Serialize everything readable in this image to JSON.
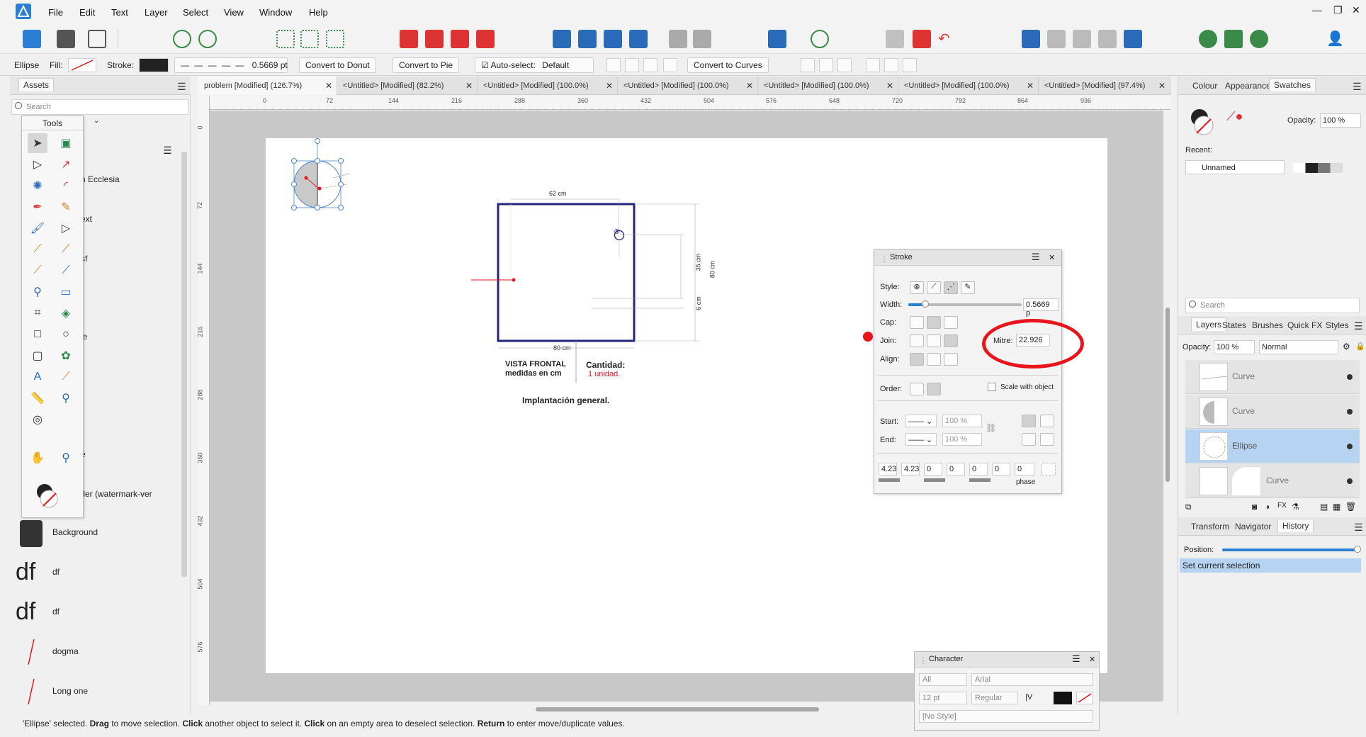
{
  "menu": [
    "File",
    "Edit",
    "Text",
    "Layer",
    "Select",
    "View",
    "Window",
    "Help"
  ],
  "context": {
    "shape": "Ellipse",
    "fill_label": "Fill:",
    "stroke_label": "Stroke:",
    "stroke_width": "0.5669 pt",
    "convert_donut": "Convert to Donut",
    "convert_pie": "Convert to Pie",
    "autoselect_label": "Auto-select:",
    "autoselect_value": "Default",
    "convert_curves": "Convert to Curves"
  },
  "assets": {
    "tab": "Assets",
    "search_placeholder": "Search",
    "category": "Tools",
    "items": [
      {
        "label": "n Ecclesia"
      },
      {
        "label": "ext"
      },
      {
        "label": "sf"
      },
      {
        "label": "le"
      },
      {
        "label": "e"
      },
      {
        "label": "tler (watermark-ver"
      },
      {
        "label": "Background"
      },
      {
        "label": "df",
        "thumb": "df"
      },
      {
        "label": "df",
        "thumb": "df"
      },
      {
        "label": "dogma"
      },
      {
        "label": "Long one"
      }
    ]
  },
  "doc_tabs": [
    "problem [Modified] (126.7%)",
    "<Untitled> [Modified] (82.2%)",
    "<Untitled> [Modified] (100.0%)",
    "<Untitled> [Modified] (100.0%)",
    "<Untitled> [Modified] (100.0%)",
    "<Untitled> [Modified] (100.0%)",
    "<Untitled> [Modified] (97.4%)"
  ],
  "ruler_h": [
    "0",
    "72",
    "144",
    "216",
    "288",
    "360",
    "432",
    "504",
    "576",
    "648",
    "720",
    "792",
    "864",
    "936"
  ],
  "ruler_v": [
    "0",
    "72",
    "144",
    "216",
    "288",
    "360",
    "432",
    "504",
    "576"
  ],
  "ruler_unit": "pt",
  "drawing": {
    "dim_top": "62 cm",
    "dim_bottom": "80 cm",
    "dim_right_35": "35 cm",
    "dim_right_80": "80 cm",
    "dim_right_6": "6 cm",
    "vista_line1": "VISTA FRONTAL",
    "vista_line2": "medidas en cm",
    "cantidad_label": "Cantidad:",
    "cantidad_value": "1 unidad.",
    "implantacion": "Implantación general.",
    "registered": "®"
  },
  "stroke_panel": {
    "title": "Stroke",
    "style_label": "Style:",
    "width_label": "Width:",
    "width_value": "0.5669 p",
    "width_fraction": 0.15,
    "cap_label": "Cap:",
    "join_label": "Join:",
    "mitre_label": "Mitre:",
    "mitre_value": "22.926",
    "align_label": "Align:",
    "order_label": "Order:",
    "scale_label": "Scale with object",
    "start_label": "Start:",
    "end_label": "End:",
    "start_pct": "100 %",
    "end_pct": "100 %",
    "dash_values": [
      "4.23",
      "4.23",
      "0",
      "0",
      "0",
      "0"
    ],
    "phase_value": "0",
    "phase_label": "phase"
  },
  "right_panel": {
    "top_tabs": [
      "Colour",
      "Appearance",
      "Swatches"
    ],
    "opacity_label": "Opacity:",
    "opacity_value": "100 %",
    "recent_label": "Recent:",
    "palette_name": "Unnamed",
    "search_placeholder": "Search",
    "layer_tabs": [
      "Layers",
      "States",
      "Brushes",
      "Quick FX",
      "Styles"
    ],
    "layer_opacity_label": "Opacity:",
    "layer_opacity": "100 %",
    "blend_mode": "Normal",
    "layers": [
      {
        "name": "Curve",
        "selected": false
      },
      {
        "name": "Curve",
        "selected": false
      },
      {
        "name": "Ellipse",
        "selected": true
      },
      {
        "name": "Curve",
        "selected": false
      }
    ],
    "bottom_tabs": [
      "Transform",
      "Navigator",
      "History"
    ],
    "position_label": "Position:",
    "history_item": "Set current selection"
  },
  "character_panel": {
    "title": "Character",
    "collection": "All",
    "font": "Arial",
    "size": "12 pt",
    "weight": "Regular",
    "style": "[No Style]"
  },
  "status": {
    "q1": "'Ellipse' selected.",
    "b1": "Drag",
    "t1": "to move selection.",
    "b2": "Click",
    "t2": "another object to select it.",
    "b3": "Click",
    "t3": "on an empty area to deselect selection.",
    "b4": "Return",
    "t4": "to enter move/duplicate values."
  },
  "colors": {
    "accent": "#2a7fd4",
    "annotation_red": "#e8141b",
    "drawing_blue": "#1f2580",
    "selection_blue": "#b7d3f2"
  }
}
